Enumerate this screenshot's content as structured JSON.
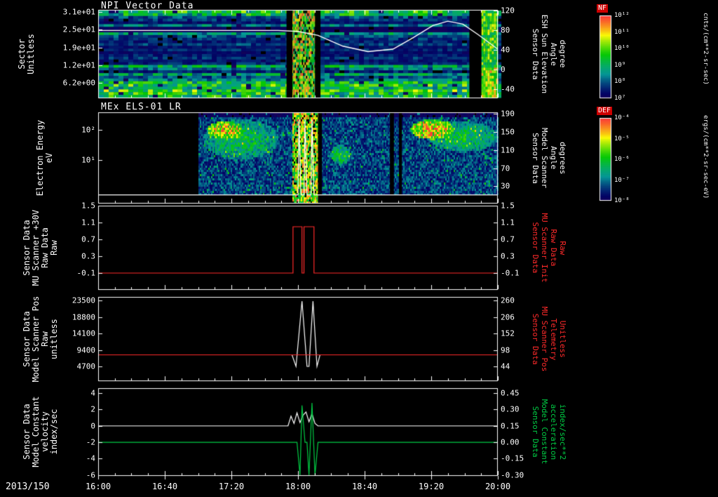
{
  "page": {
    "background": "#000000"
  },
  "x_axis": {
    "date": "2013/150",
    "xlim": [
      16,
      20
    ],
    "ticks": [
      {
        "label": "16:00",
        "v": 16
      },
      {
        "label": "16:40",
        "v": 16.6667
      },
      {
        "label": "17:20",
        "v": 17.3333
      },
      {
        "label": "18:00",
        "v": 18
      },
      {
        "label": "18:40",
        "v": 18.6667
      },
      {
        "label": "19:20",
        "v": 19.3333
      },
      {
        "label": "20:00",
        "v": 20
      }
    ]
  },
  "chart_data": [
    {
      "id": "npi",
      "type": "heatmap",
      "title": "NPI Vector Data",
      "left_axis": {
        "label": "Sector\nUnitless",
        "ticks": [
          {
            "label": "3.1e+01",
            "f": 0.025
          },
          {
            "label": "2.5e+01",
            "f": 0.225
          },
          {
            "label": "1.9e+01",
            "f": 0.425
          },
          {
            "label": "1.2e+01",
            "f": 0.625
          },
          {
            "label": "6.2e+00",
            "f": 0.825
          }
        ]
      },
      "right_axis": {
        "label": "Sensor Data\nESH Sun Elevation\nAngle\ndegree",
        "color": "#ffffff",
        "ylim": [
          -58,
          122
        ],
        "ticks": [
          {
            "label": "120",
            "v": 120
          },
          {
            "label": "80",
            "v": 80
          },
          {
            "label": "40",
            "v": 40
          },
          {
            "label": "0",
            "v": 0
          },
          {
            "label": "-40",
            "v": -40
          }
        ]
      },
      "colorbar": {
        "label": "NF",
        "units": "cnts/(cm**2-sr-sec)",
        "ticks": [
          "10¹²",
          "10¹¹",
          "10¹⁰",
          "10⁹",
          "10⁸",
          "10⁷"
        ]
      },
      "row_intensity": [
        0.5,
        0.45,
        0.22,
        0.18,
        0.12,
        0.3,
        0.08,
        0.06,
        0.35,
        0.22,
        0.18,
        0.14,
        0.2,
        0.12,
        0.16,
        0.1,
        0.14,
        0.18,
        0.12,
        0.16,
        0.42,
        0.28,
        0.16,
        0.38,
        0.22,
        0.3,
        0.46,
        0.52,
        0.44,
        0.55,
        0.5,
        0.46
      ],
      "features": {
        "band": [
          17.94,
          18.17
        ],
        "black_columns": [
          [
            17.885,
            17.945
          ],
          [
            18.17,
            18.225
          ],
          [
            19.715,
            19.835
          ]
        ],
        "bright_region": [
          19.835,
          20
        ]
      },
      "overlay": {
        "name": "sun-elevation-line",
        "color": "#ffffff",
        "points": [
          [
            16,
            80
          ],
          [
            17,
            80
          ],
          [
            17.8,
            80
          ],
          [
            18,
            78
          ],
          [
            18.2,
            70
          ],
          [
            18.45,
            48
          ],
          [
            18.7,
            37
          ],
          [
            18.95,
            42
          ],
          [
            19.15,
            65
          ],
          [
            19.35,
            90
          ],
          [
            19.5,
            99
          ],
          [
            19.65,
            93
          ],
          [
            19.8,
            72
          ],
          [
            20,
            42
          ]
        ]
      }
    },
    {
      "id": "els",
      "type": "heatmap",
      "title": "MEx ELS-01 LR",
      "left_axis": {
        "label": "Electron Energy\neV",
        "scale": "log",
        "ylim": [
          0.36,
          380
        ],
        "ticks": [
          {
            "label": "10²",
            "v": 100
          },
          {
            "label": "10¹",
            "v": 10
          }
        ]
      },
      "right_axis": {
        "label": "Sensor Data\nModel Scanner\nAngle\ndegrees",
        "color": "#ffffff",
        "ylim": [
          -8,
          193
        ],
        "ticks": [
          {
            "label": "190",
            "v": 190
          },
          {
            "label": "150",
            "v": 150
          },
          {
            "label": "110",
            "v": 110
          },
          {
            "label": "70",
            "v": 70
          },
          {
            "label": "30",
            "v": 30
          }
        ]
      },
      "colorbar": {
        "label": "DEF",
        "units": "ergs/(cm**2-sr-sec-eV)",
        "ticks": [
          "10⁻⁴",
          "10⁻⁵",
          "10⁻⁶",
          "10⁻⁷",
          "10⁻⁸"
        ]
      },
      "features": {
        "no_data_before": 17,
        "band": [
          17.93,
          18.2
        ],
        "black_columns": [
          [
            18.2,
            18.24
          ],
          [
            18.92,
            18.96
          ],
          [
            19.01,
            19.04
          ]
        ],
        "blobs": [
          {
            "t": [
              17.05,
              17.8
            ],
            "f": [
              0.06,
              0.5
            ],
            "v": 0.55
          },
          {
            "t": [
              17.08,
              17.45
            ],
            "f": [
              0.08,
              0.28
            ],
            "v": 0.95
          },
          {
            "t": [
              18.32,
              18.52
            ],
            "f": [
              0.34,
              0.56
            ],
            "v": 0.6
          },
          {
            "t": [
              19.12,
              19.55
            ],
            "f": [
              0.06,
              0.28
            ],
            "v": 0.97
          },
          {
            "t": [
              19.3,
              20
            ],
            "f": [
              0.08,
              0.42
            ],
            "v": 0.55
          }
        ]
      },
      "overlay": {
        "name": "els-monitor-line",
        "color": "#ffffff",
        "points": [
          [
            16,
            0.7
          ],
          [
            18,
            0.7
          ],
          [
            18.01,
            220
          ],
          [
            18.03,
            0.7
          ],
          [
            18.06,
            0.7
          ],
          [
            18.07,
            220
          ],
          [
            18.09,
            0.7
          ],
          [
            18.13,
            0.7
          ],
          [
            18.14,
            220
          ],
          [
            18.16,
            0.7
          ],
          [
            20,
            0.7
          ]
        ]
      }
    },
    {
      "id": "mu-scanner-30v",
      "type": "line",
      "left_axis": {
        "label": "Sensor Data\nMU Scanner +30V\nRaw Data\nRaw",
        "ylim": [
          -0.5,
          1.5
        ],
        "ticks": [
          {
            "label": "1.5",
            "v": 1.5
          },
          {
            "label": "1.1",
            "v": 1.1
          },
          {
            "label": "0.7",
            "v": 0.7
          },
          {
            "label": "0.3",
            "v": 0.3
          },
          {
            "label": "-0.1",
            "v": -0.1
          }
        ]
      },
      "right_axis": {
        "label": "Sensor Data\nMU Scanner Init\nRaw Data\nRaw",
        "color": "#ff2a2a",
        "ylim": [
          -0.5,
          1.5
        ],
        "ticks": [
          {
            "label": "1.5",
            "v": 1.5
          },
          {
            "label": "1.1",
            "v": 1.1
          },
          {
            "label": "0.7",
            "v": 0.7
          },
          {
            "label": "0.3",
            "v": 0.3
          },
          {
            "label": "-0.1",
            "v": -0.1
          }
        ]
      },
      "series": [
        {
          "name": "mu-scanner-init-raw",
          "color": "#ff2a2a",
          "points": [
            [
              16,
              -0.1
            ],
            [
              17.95,
              -0.1
            ],
            [
              17.95,
              1
            ],
            [
              18.04,
              1
            ],
            [
              18.04,
              -0.1
            ],
            [
              18.06,
              -0.1
            ],
            [
              18.06,
              1
            ],
            [
              18.16,
              1
            ],
            [
              18.16,
              -0.1
            ],
            [
              20,
              -0.1
            ]
          ]
        }
      ]
    },
    {
      "id": "scanner-pos",
      "type": "line",
      "left_axis": {
        "label": "Sensor Data\nModel Scanner Pos\nRaw\nunitless",
        "ylim": [
          500,
          24500
        ],
        "ticks": [
          {
            "label": "23500",
            "v": 23500
          },
          {
            "label": "18800",
            "v": 18800
          },
          {
            "label": "14100",
            "v": 14100
          },
          {
            "label": "9400",
            "v": 9400
          },
          {
            "label": "4700",
            "v": 4700
          }
        ]
      },
      "right_axis": {
        "label": "Sensor Data\nMU Scanner Pos\nTelemetry\nUnitless",
        "color": "#ff2a2a",
        "ylim": [
          -4,
          272
        ],
        "ticks": [
          {
            "label": "260",
            "v": 260
          },
          {
            "label": "206",
            "v": 206
          },
          {
            "label": "152",
            "v": 152
          },
          {
            "label": "98",
            "v": 98
          },
          {
            "label": "44",
            "v": 44
          }
        ]
      },
      "series": [
        {
          "name": "model-scanner-pos",
          "color": "#ffffff",
          "points": [
            [
              16,
              8000
            ],
            [
              17.94,
              8000
            ],
            [
              17.98,
              4700
            ],
            [
              18.04,
              23300
            ],
            [
              18.09,
              4700
            ],
            [
              18.11,
              4700
            ],
            [
              18.15,
              23300
            ],
            [
              18.19,
              4700
            ],
            [
              18.22,
              8000
            ],
            [
              20,
              8000
            ]
          ]
        },
        {
          "name": "mu-scanner-pos-telemetry",
          "color": "#ff2a2a",
          "points": [
            [
              16,
              8000
            ],
            [
              20,
              8000
            ]
          ]
        }
      ]
    },
    {
      "id": "model-constant",
      "type": "line",
      "left_axis": {
        "label": "Sensor Data\nModel Constant\nvelocity\nindex/sec",
        "ylim": [
          -6.1,
          4.6
        ],
        "ticks": [
          {
            "label": "4",
            "v": 4
          },
          {
            "label": "2",
            "v": 2
          },
          {
            "label": "0",
            "v": 0
          },
          {
            "label": "-2",
            "v": -2
          },
          {
            "label": "-4",
            "v": -4
          },
          {
            "label": "-6",
            "v": -6
          }
        ]
      },
      "right_axis": {
        "label": "Sensor Data\nModel Constant\nacceleration\nindex/sec**2",
        "color": "#00cc44",
        "ylim": [
          -0.3075,
          0.495
        ],
        "ticks": [
          {
            "label": "0.45",
            "v": 0.45
          },
          {
            "label": "0.30",
            "v": 0.3
          },
          {
            "label": "0.15",
            "v": 0.15
          },
          {
            "label": "0.00",
            "v": 0
          },
          {
            "label": "-0.15",
            "v": -0.15
          },
          {
            "label": "-0.30",
            "v": -0.3
          }
        ]
      },
      "series": [
        {
          "name": "velocity",
          "color": "#ffffff",
          "points": [
            [
              16,
              0
            ],
            [
              17.9,
              0
            ],
            [
              17.93,
              1.2
            ],
            [
              17.96,
              0.3
            ],
            [
              17.99,
              1.6
            ],
            [
              18.02,
              0.4
            ],
            [
              18.05,
              1.3
            ],
            [
              18.08,
              1.7
            ],
            [
              18.11,
              0.5
            ],
            [
              18.14,
              1.5
            ],
            [
              18.17,
              0.3
            ],
            [
              18.2,
              0
            ],
            [
              20,
              0
            ]
          ]
        },
        {
          "name": "acceleration",
          "color": "#00cc44",
          "points": [
            [
              16,
              -2
            ],
            [
              17.99,
              -2
            ],
            [
              18.02,
              -6
            ],
            [
              18.04,
              2.5
            ],
            [
              18.07,
              -2
            ],
            [
              18.09,
              -2
            ],
            [
              18.11,
              -6
            ],
            [
              18.14,
              2.8
            ],
            [
              18.17,
              -6
            ],
            [
              18.2,
              -2
            ],
            [
              20,
              -2
            ]
          ]
        }
      ]
    }
  ]
}
